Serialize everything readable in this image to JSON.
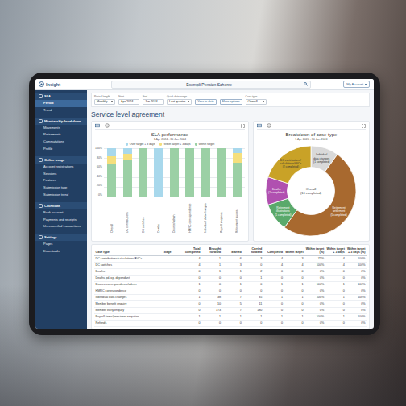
{
  "app": {
    "logo": "Insight"
  },
  "header": {
    "scheme": "Exempli Pension Scheme",
    "account": "My Account"
  },
  "sidebar": {
    "sections": [
      {
        "title": "SLA",
        "items": [
          {
            "label": "Period",
            "selected": true
          },
          {
            "label": "Trend",
            "selected": false
          }
        ]
      },
      {
        "title": "Membership breakdown",
        "items": [
          {
            "label": "Movements",
            "selected": false
          },
          {
            "label": "Retirements",
            "selected": false
          },
          {
            "label": "Commutations",
            "selected": false
          },
          {
            "label": "Profile",
            "selected": false
          }
        ]
      },
      {
        "title": "Online usage",
        "items": [
          {
            "label": "Account registrations",
            "selected": false
          },
          {
            "label": "Sessions",
            "selected": false
          },
          {
            "label": "Features",
            "selected": false
          },
          {
            "label": "Submission type",
            "selected": false
          },
          {
            "label": "Submission trend",
            "selected": false
          }
        ]
      },
      {
        "title": "Cashflows",
        "items": [
          {
            "label": "Bank account",
            "selected": false
          },
          {
            "label": "Payments and receipts",
            "selected": false
          },
          {
            "label": "Unreconciled transactions",
            "selected": false
          }
        ]
      },
      {
        "title": "Settings",
        "items": [
          {
            "label": "Pages",
            "selected": false
          },
          {
            "label": "Downloads",
            "selected": false
          }
        ]
      }
    ]
  },
  "filters": [
    {
      "kind": "select",
      "label": "Period length",
      "value": "Monthly"
    },
    {
      "kind": "field",
      "label": "Start",
      "value": "Apr 2024"
    },
    {
      "kind": "field",
      "label": "End",
      "value": "Jun 2024"
    },
    {
      "kind": "select",
      "label": "Quick date range",
      "value": "Last quarter"
    },
    {
      "kind": "button",
      "label": "",
      "value": "Year to date"
    },
    {
      "kind": "button",
      "label": "",
      "value": "More options"
    },
    {
      "kind": "select",
      "label": "Case type",
      "value": "Overall"
    }
  ],
  "page_title": "Service level agreement",
  "sla_chart": {
    "title": "SLA performance",
    "date_range": "1 Apr 2024 - 30 Jun 2024",
    "y_ticks": [
      "100%",
      "80%",
      "60%",
      "40%",
      "20%",
      "0%"
    ],
    "categories": [
      "Overall",
      "DC contributions",
      "DC switches",
      "Deaths",
      "Divorce/admin",
      "HMRC correspondence",
      "Individual data changes",
      "Payroll enquiries",
      "Retirement quotes"
    ],
    "series": [
      {
        "name": "Over target + 3 days",
        "color": "#a8d8ec",
        "values": [
          17,
          12,
          0,
          100,
          0,
          0,
          0,
          0,
          10
        ]
      },
      {
        "name": "Within target + 3 days",
        "color": "#f5df7d",
        "values": [
          15,
          13,
          0,
          0,
          0,
          0,
          0,
          0,
          20
        ]
      },
      {
        "name": "Within target",
        "color": "#9bd0a5",
        "values": [
          68,
          75,
          100,
          0,
          100,
          100,
          100,
          100,
          70
        ]
      }
    ]
  },
  "breakdown_chart": {
    "title": "Breakdown of case type",
    "date_range": "1 Apr 2024 - 30 Jun 2024",
    "center": [
      "Overall",
      "(10 completed)"
    ],
    "segments": [
      {
        "lines": [
          "Individual",
          "data changes",
          "(1 completed)"
        ],
        "value": 1,
        "color": "#d9d9d9"
      },
      {
        "lines": [
          "Retirement",
          "settlement",
          "(5 completed)"
        ],
        "value": 5,
        "color": "#a8692f"
      },
      {
        "lines": [
          "Retirement",
          "illustrations",
          "(1 completed)"
        ],
        "value": 1,
        "color": "#5aa96b"
      },
      {
        "lines": [
          "Deaths",
          "(1 completed)"
        ],
        "value": 1,
        "color": "#b050b0"
      },
      {
        "lines": [
          "DC contributions/",
          "calculations/AVCs",
          "(2 completed)"
        ],
        "value": 2,
        "color": "#c9a227"
      }
    ]
  },
  "table": {
    "columns": [
      "Case type",
      "Stage",
      "Total completed",
      "Brought forward",
      "Started",
      "Carried forward",
      "Completed",
      "Within target",
      "Within target (%)",
      "Within target + 3 days",
      "Within target + 3 days (%)"
    ],
    "rows": [
      [
        "DC contributions/calculations/AVCs",
        "",
        "4",
        "1",
        "6",
        "3",
        "4",
        "3",
        "75%",
        "4",
        "100%"
      ],
      [
        "DC switches",
        "",
        "4",
        "1",
        "3",
        "0",
        "4",
        "4",
        "100%",
        "4",
        "100%"
      ],
      [
        "Deaths",
        "",
        "0",
        "1",
        "1",
        "2",
        "0",
        "0",
        "0%",
        "0",
        "0%"
      ],
      [
        "Deaths pd. op. dependant",
        "",
        "0",
        "0",
        "0",
        "1",
        "0",
        "0",
        "0%",
        "0",
        "0%"
      ],
      [
        "Divorce correspondence/admin",
        "",
        "1",
        "0",
        "1",
        "0",
        "1",
        "1",
        "100%",
        "1",
        "100%"
      ],
      [
        "HMRC correspondence",
        "",
        "0",
        "0",
        "0",
        "0",
        "0",
        "0",
        "0%",
        "0",
        "0%"
      ],
      [
        "Individual data changes",
        "",
        "1",
        "38",
        "7",
        "35",
        "1",
        "1",
        "100%",
        "1",
        "100%"
      ],
      [
        "Member benefit enquiry",
        "",
        "0",
        "10",
        "5",
        "11",
        "0",
        "0",
        "0%",
        "0",
        "0%"
      ],
      [
        "Member early enquiry",
        "",
        "0",
        "173",
        "7",
        "180",
        "0",
        "0",
        "0%",
        "0",
        "0%"
      ],
      [
        "Payroll items/pensioner enquiries",
        "",
        "1",
        "1",
        "1",
        "1",
        "1",
        "1",
        "100%",
        "1",
        "100%"
      ],
      [
        "Refunds",
        "",
        "0",
        "0",
        "0",
        "0",
        "0",
        "0",
        "0%",
        "0",
        "0%"
      ]
    ]
  }
}
